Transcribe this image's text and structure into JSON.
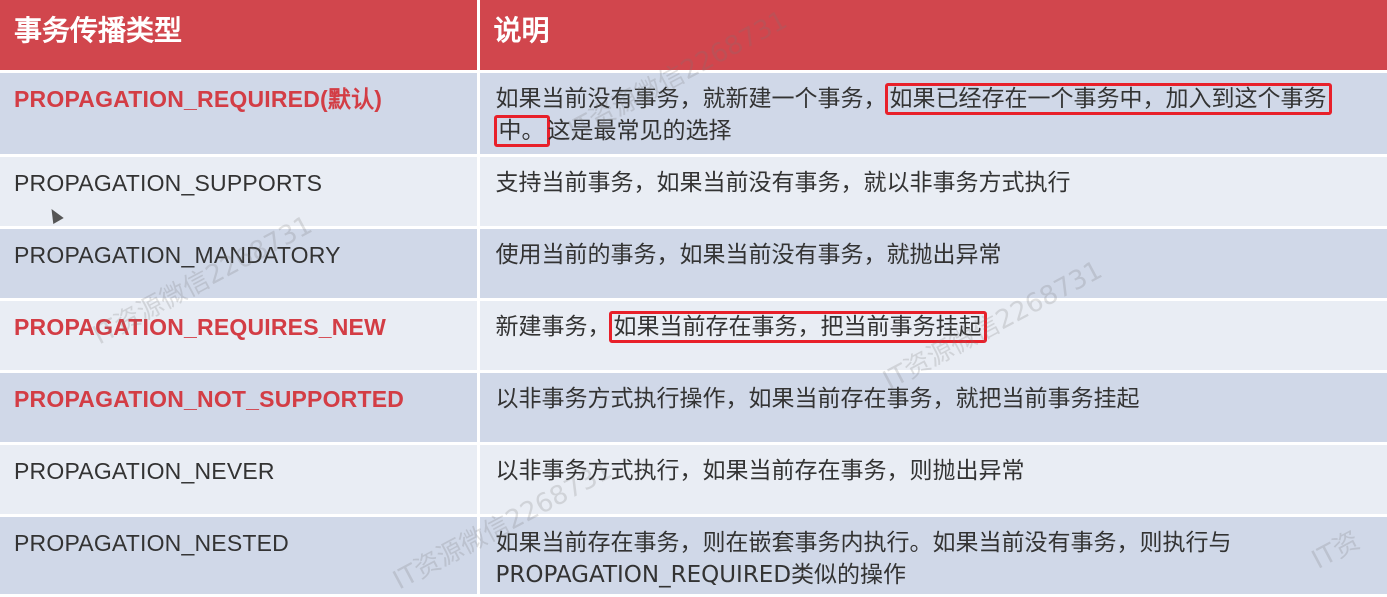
{
  "table": {
    "headers": [
      "事务传播类型",
      "说明"
    ],
    "rows": [
      {
        "name": "PROPAGATION_REQUIRED(默认)",
        "highlight": true,
        "desc_pre": "如果当前没有事务，就新建一个事务，",
        "desc_box": "如果已经存在一个事务中，加入到这个事务中。",
        "desc_post": "这是最常见的选择"
      },
      {
        "name": "PROPAGATION_SUPPORTS",
        "highlight": false,
        "desc_pre": "支持当前事务，如果当前没有事务，就以非事务方式执行",
        "desc_box": "",
        "desc_post": ""
      },
      {
        "name": "PROPAGATION_MANDATORY",
        "highlight": false,
        "desc_pre": "使用当前的事务，如果当前没有事务，就抛出异常",
        "desc_box": "",
        "desc_post": ""
      },
      {
        "name": "PROPAGATION_REQUIRES_NEW",
        "highlight": true,
        "desc_pre": "新建事务，",
        "desc_box": "如果当前存在事务，把当前事务挂起",
        "desc_post": ""
      },
      {
        "name": "PROPAGATION_NOT_SUPPORTED",
        "highlight": true,
        "desc_pre": "以非事务方式执行操作，如果当前存在事务，就把当前事务挂起",
        "desc_box": "",
        "desc_post": ""
      },
      {
        "name": "PROPAGATION_NEVER",
        "highlight": false,
        "desc_pre": "以非事务方式执行，如果当前存在事务，则抛出异常",
        "desc_box": "",
        "desc_post": ""
      },
      {
        "name": "PROPAGATION_NESTED",
        "highlight": false,
        "desc_pre": "如果当前存在事务，则在嵌套事务内执行。如果当前没有事务，则执行与PROPAGATION_REQUIRED类似的操作",
        "desc_box": "",
        "desc_post": ""
      }
    ]
  },
  "watermarks": [
    "IT资源微信2268731",
    "IT资源微信2268731",
    "IT资源微信2268731",
    "IT资源微信2268731",
    "IT资"
  ],
  "colors": {
    "header_bg": "#d1464d",
    "highlight_text": "#d33d45",
    "box_border": "#e8202a",
    "row_dark": "#d0d8e8",
    "row_light": "#e9edf4"
  }
}
